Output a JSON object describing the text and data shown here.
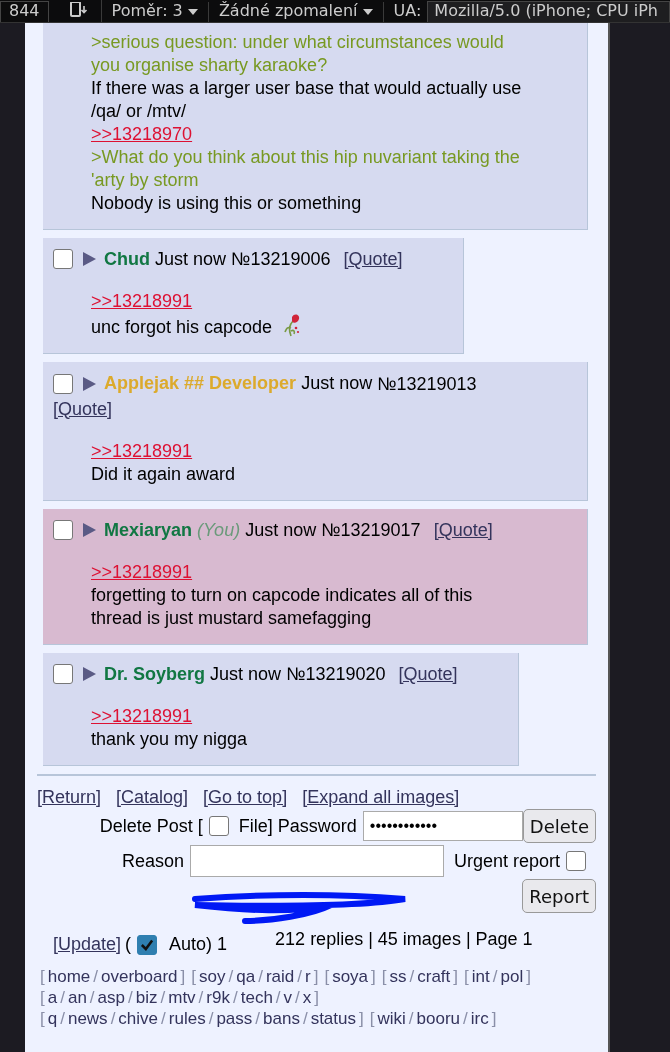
{
  "devtools_bar": {
    "width_value": "844",
    "ratio": "Poměr: 3",
    "throttling": "Žádné zpomalení",
    "ua_label": "UA:",
    "ua_value": "Mozilla/5.0 (iPhone; CPU iPh"
  },
  "posts": [
    {
      "highlighted": false,
      "lines": [
        {
          "kind": "greentext",
          "text": ">serious question: under what circumstances would you organise sharty karaoke?"
        },
        {
          "kind": "text",
          "text": "If there was a larger user base that would actually use /qa/ or /mtv/"
        },
        {
          "kind": "quotelink",
          "text": ">>13218970"
        },
        {
          "kind": "greentext",
          "text": ">What do you think about this hip nuvariant taking the 'arty by storm"
        },
        {
          "kind": "text",
          "text": "Nobody is using this or something"
        }
      ]
    },
    {
      "header": {
        "checked": false,
        "name": "Chud",
        "color": "#117743",
        "time": "Just now",
        "number": "№13219006",
        "quote": "[Quote]"
      },
      "highlighted": false,
      "lines": [
        {
          "kind": "quotelink",
          "text": ">>13218991"
        },
        {
          "kind": "text",
          "text": "unc forgot his capcode",
          "trailing_icon": true
        }
      ]
    },
    {
      "header": {
        "checked": false,
        "name": "Applejak ## Developer",
        "color": "#dcaa2c",
        "time": "Just now",
        "number": "№13219013",
        "quote": "[Quote]"
      },
      "highlighted": false,
      "lines": [
        {
          "kind": "quotelink",
          "text": ">>13218991"
        },
        {
          "kind": "text",
          "text": "Did it again award"
        }
      ]
    },
    {
      "header": {
        "checked": false,
        "name": "Mexiaryan",
        "color": "#117743",
        "you": "(You)",
        "time": "Just now",
        "number": "№13219017",
        "quote": "[Quote]"
      },
      "highlighted": true,
      "lines": [
        {
          "kind": "quotelink",
          "text": ">>13218991"
        },
        {
          "kind": "text",
          "text": "forgetting to turn on capcode indicates all of this thread is just mustard samefagging"
        }
      ]
    },
    {
      "header": {
        "checked": false,
        "name": "Dr. Soyberg",
        "color": "#117743",
        "time": "Just now",
        "number": "№13219020",
        "quote": "[Quote]"
      },
      "highlighted": false,
      "lines": [
        {
          "kind": "quotelink",
          "text": ">>13218991"
        },
        {
          "kind": "text",
          "text": "thank you my nigga"
        }
      ]
    }
  ],
  "thread_links": [
    "[Return]",
    "[Catalog]",
    "[Go to top]",
    "[Expand all images]"
  ],
  "delete_form": {
    "label_before": "Delete Post [",
    "file_checked": false,
    "label_after": "File] Password",
    "password_value": "••••••••••••",
    "delete_button": "Delete",
    "reason_label": "Reason",
    "urgent_label": "Urgent report",
    "urgent_checked": false,
    "report_button": "Report"
  },
  "update": {
    "link": "[Update]",
    "open": "(",
    "auto_checked": true,
    "auto_label": "Auto) 1",
    "stats": "212 replies | 45 images | Page 1"
  },
  "board_nav": {
    "open": "[",
    "close": "]",
    "separator": "/",
    "groups": [
      [
        "home",
        "overboard"
      ],
      [
        "soy",
        "qa",
        "raid",
        "r"
      ],
      [
        "soya"
      ],
      [
        "ss",
        "craft"
      ],
      [
        "int",
        "pol"
      ],
      [
        "a",
        "an",
        "asp",
        "biz",
        "mtv",
        "r9k",
        "tech",
        "v",
        "x"
      ],
      [
        "q",
        "news",
        "chive",
        "rules",
        "pass",
        "bans",
        "status"
      ],
      [
        "wiki",
        "booru",
        "irc"
      ]
    ]
  }
}
